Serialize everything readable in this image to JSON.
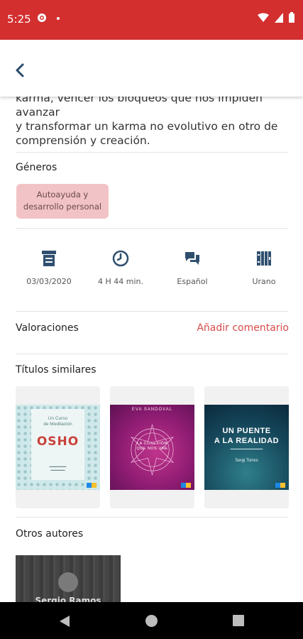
{
  "status_bar": {
    "time": "5:25"
  },
  "description": {
    "lines": [
      "karma, vencer los bloqueos que nos impiden avanzar",
      "y transformar un karma no evolutivo en otro de",
      "comprensión y creación."
    ]
  },
  "genres": {
    "title": "Géneros",
    "chip_line1": "Autoayuda y",
    "chip_line2": "desarrollo personal"
  },
  "metadata": {
    "date": "03/03/2020",
    "duration": "4 H 44 min.",
    "language": "Español",
    "publisher": "Urano"
  },
  "ratings": {
    "title": "Valoraciones",
    "add_comment": "Añadir comentario"
  },
  "similar": {
    "title": "Títulos similares",
    "books": [
      {
        "line1": "Un Curso",
        "line2": "de Meditación",
        "brand": "OSHO"
      },
      {
        "author": "EVA SANDOVAL",
        "line1": "LA CONEXIÓN",
        "line2": "QUE NOS UNE"
      },
      {
        "line1": "UN PUENTE",
        "line2": "A LA REALIDAD",
        "author": "Sergi Torres"
      }
    ]
  },
  "other_authors": {
    "title": "Otros autores",
    "name": "Sergio Ramos"
  },
  "colors": {
    "primary": "#d32f2f",
    "accent": "#d84a4a",
    "chip": "#f2c3c6",
    "icon": "#2f4f6f"
  }
}
